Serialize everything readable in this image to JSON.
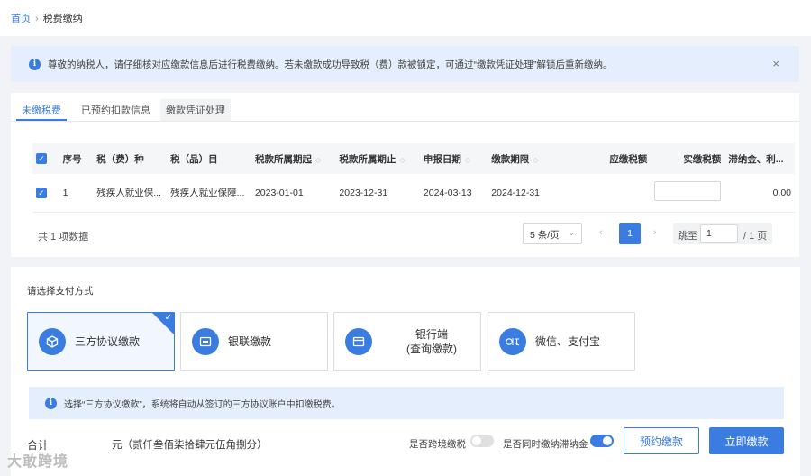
{
  "breadcrumb": {
    "home": "首页",
    "separator": "›",
    "current": "税费缴纳"
  },
  "notice": {
    "text": "尊敬的纳税人，请仔细核对应缴款信息后进行税费缴纳。若未缴款成功导致税（费）款被锁定，可通过“缴款凭证处理”解锁后重新缴纳。",
    "close": "×"
  },
  "tabs": [
    {
      "label": "未缴税费"
    },
    {
      "label": "已预约扣款信息"
    },
    {
      "label": "缴款凭证处理"
    }
  ],
  "table": {
    "headers": [
      "序号",
      "税（费）种",
      "税（品）目",
      "税款所属期起",
      "税款所属期止",
      "申报日期",
      "缴款期限",
      "应缴税额",
      "实缴税额",
      "滞纳金、利..."
    ],
    "rows": [
      [
        "1",
        "残疾人就业保...",
        "残疾人就业保障...",
        "2023-01-01",
        "2023-12-31",
        "2024-03-13",
        "2024-12-31",
        "",
        "",
        "0.00"
      ]
    ]
  },
  "pagination": {
    "total": "共 1 项数据",
    "page_size": "5 条/页",
    "current_page": "1",
    "jump_label": "跳至",
    "jump_value": "1",
    "total_pages": "/ 1 页"
  },
  "payment": {
    "title": "请选择支付方式",
    "options": [
      {
        "label": "三方协议缴款",
        "selected": true
      },
      {
        "label": "银联缴款",
        "selected": false
      },
      {
        "label": "银行端\n(查询缴款)",
        "selected": false
      },
      {
        "label": "微信、支付宝",
        "selected": false
      }
    ],
    "hint": "选择“三方协议缴款”，系统将自动从签订的三方协议账户中扣缴税费。"
  },
  "footer": {
    "total_label": "合计",
    "amount": "元（贰仟叁佰柒拾肆元伍角捌分）",
    "cross_border_label": "是否跨境缴税",
    "late_fee_label": "是否同时缴纳滞纳金",
    "reserve_button": "预约缴款",
    "pay_button": "立即缴款"
  },
  "watermark": "大敢跨境",
  "colors": {
    "primary": "#3a7ce0",
    "notice_bg": "#e4eefc"
  }
}
